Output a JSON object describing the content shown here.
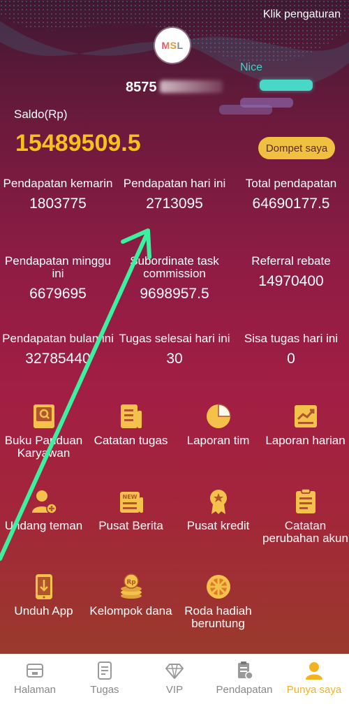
{
  "header": {
    "settings_link": "Klik pengaturan",
    "logo_text": "MSL",
    "phone_visible": "8575",
    "badge_text": "Nice"
  },
  "balance": {
    "label": "Saldo(Rp)",
    "value": "15489509.5",
    "wallet_button": "Dompet saya"
  },
  "stats": [
    {
      "label": "Pendapatan kemarin",
      "value": "1803775"
    },
    {
      "label": "Pendapatan hari ini",
      "value": "2713095"
    },
    {
      "label": "Total pendapatan",
      "value": "64690177.5"
    },
    {
      "label": "Pendapatan minggu ini",
      "value": "6679695"
    },
    {
      "label": "Subordinate task commission",
      "value": "9698957.5"
    },
    {
      "label": "Referral rebate",
      "value": "14970400"
    },
    {
      "label": "Pendapatan bulan ini",
      "value": "32785440"
    },
    {
      "label": "Tugas selesai hari ini",
      "value": "30"
    },
    {
      "label": "Sisa tugas hari ini",
      "value": "0"
    }
  ],
  "menu": [
    {
      "label": "Buku Panduan Karyawan",
      "icon": "book-icon"
    },
    {
      "label": "Catatan tugas",
      "icon": "task-record-icon"
    },
    {
      "label": "Laporan tim",
      "icon": "pie-chart-icon"
    },
    {
      "label": "Laporan harian",
      "icon": "trend-chart-icon"
    },
    {
      "label": "Undang teman",
      "icon": "invite-user-icon"
    },
    {
      "label": "Pusat Berita",
      "icon": "news-icon"
    },
    {
      "label": "Pusat kredit",
      "icon": "medal-icon"
    },
    {
      "label": "Catatan perubahan akun",
      "icon": "clipboard-icon"
    },
    {
      "label": "Unduh App",
      "icon": "download-phone-icon"
    },
    {
      "label": "Kelompok dana",
      "icon": "coin-stack-icon"
    },
    {
      "label": "Roda hadiah beruntung",
      "icon": "prize-wheel-icon"
    }
  ],
  "tabs": [
    {
      "label": "Halaman",
      "icon": "home-icon",
      "active": false
    },
    {
      "label": "Tugas",
      "icon": "task-icon",
      "active": false
    },
    {
      "label": "VIP",
      "icon": "diamond-icon",
      "active": false
    },
    {
      "label": "Pendapatan",
      "icon": "income-icon",
      "active": false
    },
    {
      "label": "Punya saya",
      "icon": "profile-icon",
      "active": true
    }
  ],
  "colors": {
    "accent_gold": "#f8c01c",
    "wallet_button_bg": "#f0c040",
    "active_tab": "#f2b320",
    "inactive_tab": "#888888",
    "annotation_arrow": "#3df0a0"
  }
}
